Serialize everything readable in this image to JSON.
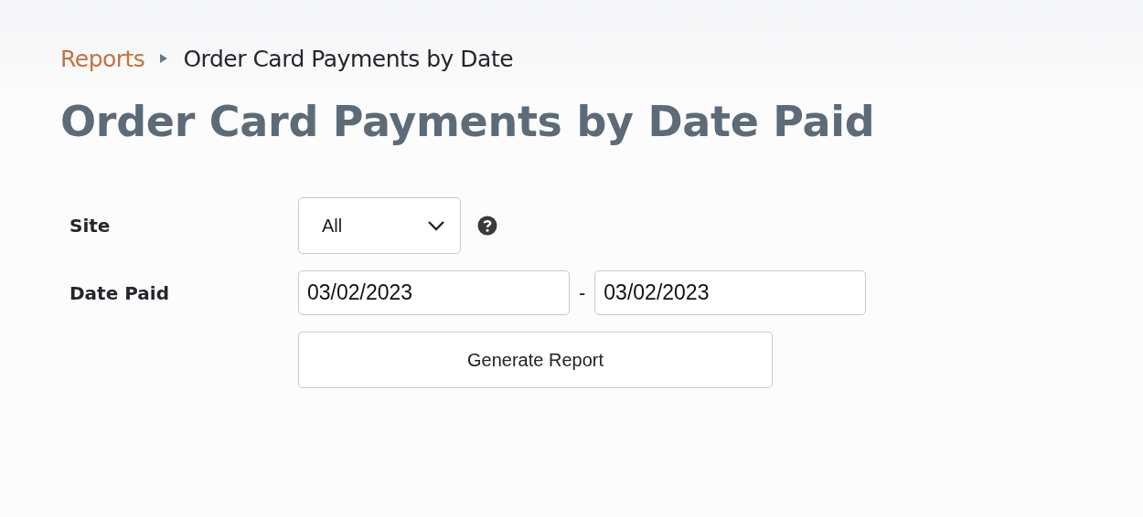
{
  "breadcrumb": {
    "link": "Reports",
    "current": "Order Card Payments by Date"
  },
  "title": "Order Card Payments by Date Paid",
  "form": {
    "site": {
      "label": "Site",
      "value": "All"
    },
    "date_paid": {
      "label": "Date Paid",
      "from": "03/02/2023",
      "separator": "-",
      "to": "03/02/2023"
    },
    "button": "Generate Report"
  }
}
